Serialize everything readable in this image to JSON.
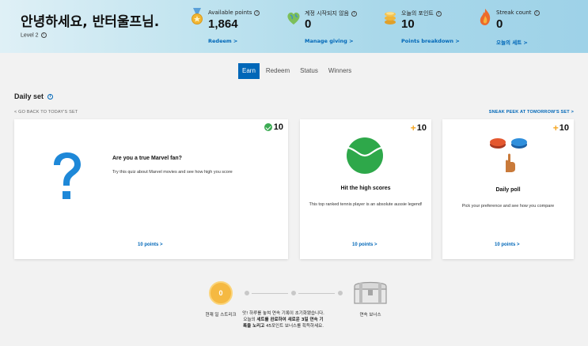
{
  "header": {
    "greeting": "안녕하세요, 반터울프님.",
    "level": "Level 2",
    "stats": [
      {
        "icon": "medal-icon",
        "label": "Available points",
        "value": "1,864",
        "link": "Redeem >"
      },
      {
        "icon": "heart-globe-icon",
        "label": "계정 시작되지 않음",
        "value": "0",
        "link": "Manage giving >"
      },
      {
        "icon": "coin-stack-icon",
        "label": "오늘의 포인트",
        "value": "10",
        "link": "Points breakdown >"
      },
      {
        "icon": "flame-icon",
        "label": "Streak count",
        "value": "0",
        "link": "오늘의 세트 >"
      }
    ]
  },
  "tabs": [
    "Earn",
    "Redeem",
    "Status",
    "Winners"
  ],
  "active_tab": "Earn",
  "daily_set": {
    "title": "Daily set",
    "back_link": "< GO BACK TO TODAY'S SET",
    "peek_link": "SNEAK PEEK AT TOMORROW'S SET >",
    "cards": [
      {
        "points": "10",
        "completed": true,
        "icon": "question-mark-icon",
        "title": "Are you a true Marvel fan?",
        "desc": "Try this quiz about Marvel movies and see how high you score",
        "link": "10 points >"
      },
      {
        "points": "10",
        "completed": false,
        "icon": "tennis-ball-icon",
        "title": "Hit the high scores",
        "desc": "This top ranked tennis player is an absolute aussie legend!",
        "link": "10 points >"
      },
      {
        "points": "10",
        "completed": false,
        "icon": "poll-buttons-icon",
        "title": "Daily poll",
        "desc": "Pick your preference and see how you compare",
        "link": "10 points >"
      }
    ]
  },
  "streak": {
    "current_value": "0",
    "current_label": "현재 일 스트리크",
    "message_1": "앗! 하루를 놓쳐 연속 기록이 초기화됐습니다. 오늘의 ",
    "message_bold_1": "세트를 완료하여 새로운 3일 연속 기록을 노리고",
    "message_2": " 45포인트 보너스를 획득하세요.",
    "bonus_label": "연속 보너스"
  },
  "colors": {
    "accent": "#0067b8",
    "success": "#3bab53",
    "plus": "#f5a623",
    "coin": "#f5b942"
  }
}
